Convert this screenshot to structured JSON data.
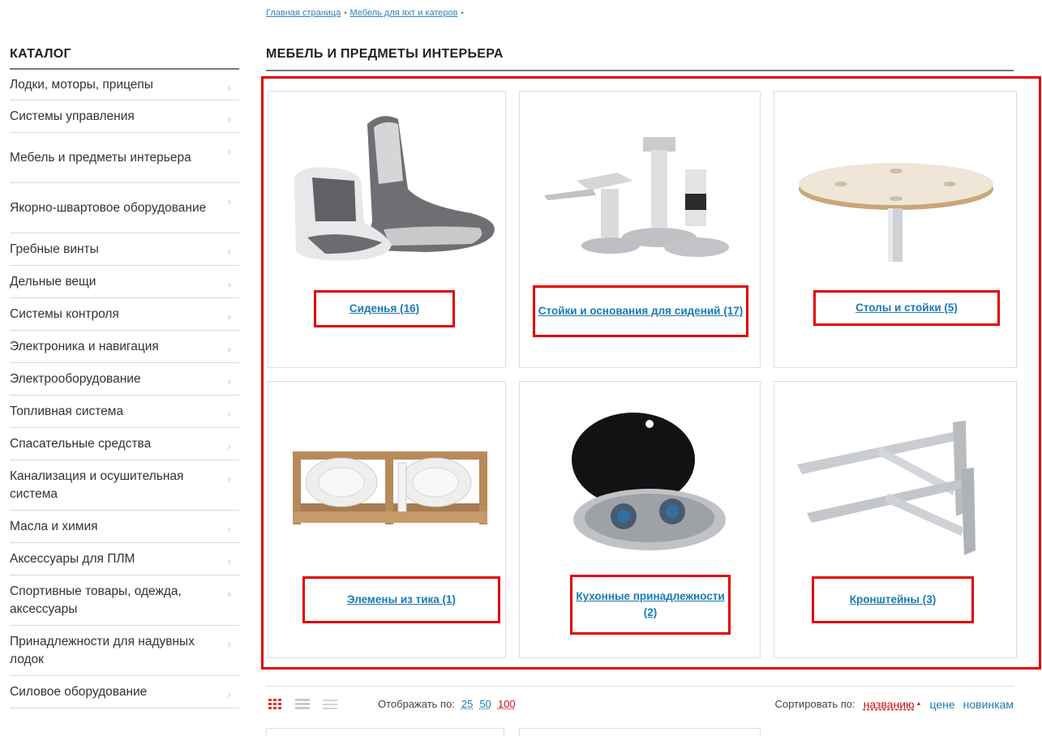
{
  "breadcrumb": {
    "home": "Главная страница",
    "current": "Мебель для яхт и катеров"
  },
  "sidebar": {
    "title": "КАТАЛОГ",
    "items": [
      "Лодки, моторы, прицепы",
      "Системы управления",
      "Мебель и предметы интерьера",
      "Якорно-швартовое оборудование",
      "Гребные винты",
      "Дельные вещи",
      "Системы контроля",
      "Электроника и навигация",
      "Электрооборудование",
      "Топливная система",
      "Спасательные средства",
      "Канализация и осушительная система",
      "Масла и химия",
      "Аксессуары для ПЛМ",
      "Спортивные товары, одежда, аксессуары",
      "Принадлежности для надувных лодок",
      "Силовое оборудование"
    ]
  },
  "main": {
    "title": "МЕБЕЛЬ И ПРЕДМЕТЫ ИНТЕРЬЕРА",
    "categories": [
      {
        "label": "Сиденья (16)",
        "icon": "boat-seats-image"
      },
      {
        "label": "Стойки и основания для сидений (17)",
        "icon": "seat-pedestal-image"
      },
      {
        "label": "Столы и стойки (5)",
        "icon": "round-table-image"
      },
      {
        "label": "Элемены из тика (1)",
        "icon": "teak-rack-image"
      },
      {
        "label": "Кухонные принадлежности (2)",
        "icon": "stove-image"
      },
      {
        "label": "Кронштейны (3)",
        "icon": "bracket-image"
      }
    ]
  },
  "toolbar": {
    "per_page_label": "Отображать по:",
    "per_page_options": [
      "25",
      "50",
      "100"
    ],
    "per_page_active": "100",
    "sort_label": "Сортировать по:",
    "sort_options": [
      "названию",
      "цене",
      "новинкам"
    ],
    "sort_active": "названию",
    "sort_direction_mark": "▲"
  },
  "colors": {
    "link": "#1a7ab3",
    "highlight_frame": "#e00000",
    "active": "#cc1111"
  }
}
